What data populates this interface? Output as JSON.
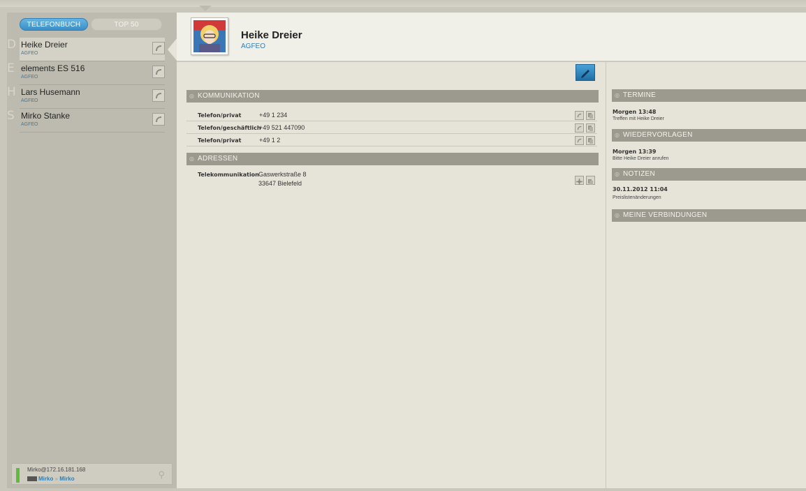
{
  "sidebar": {
    "tabs": [
      {
        "label": "TELEFONBUCH",
        "active": true
      },
      {
        "label": "TOP 50",
        "active": false
      }
    ],
    "contacts": [
      {
        "letter": "D",
        "name": "Heike Dreier",
        "org": "AGFEO",
        "selected": true
      },
      {
        "letter": "E",
        "name": "elements ES 516",
        "org": "AGFEO",
        "selected": false
      },
      {
        "letter": "H",
        "name": "Lars Husemann",
        "org": "AGFEO",
        "selected": false
      },
      {
        "letter": "S",
        "name": "Mirko Stanke",
        "org": "AGFEO",
        "selected": false
      }
    ],
    "status": {
      "user": "Mirko@172.16.181.168",
      "line_from": "Mirko",
      "line_sep": "»",
      "line_to": "Mirko",
      "status_color": "#5fbb3a"
    }
  },
  "header": {
    "name": "Heike Dreier",
    "org": "AGFEO"
  },
  "main": {
    "edit_icon": "pencil-icon",
    "kommunikation": {
      "title": "KOMMUNIKATION",
      "rows": [
        {
          "label": "Telefon/privat",
          "value": "+49 1 234"
        },
        {
          "label": "Telefon/geschäftlich",
          "value": "+49 521 447090"
        },
        {
          "label": "Telefon/privat",
          "value": "+49 1 2"
        }
      ]
    },
    "adressen": {
      "title": "ADRESSEN",
      "label": "Telekommunikation",
      "street": "Gaswerkstraße 8",
      "city": "33647 Bielefeld"
    }
  },
  "right": {
    "termine": {
      "title": "TERMINE",
      "time": "Morgen 13:48",
      "text": "Treffen mit Heike Dreier"
    },
    "wiedervorlagen": {
      "title": "WIEDERVORLAGEN",
      "time": "Morgen 13:39",
      "text": "Bitte Heike Dreier anrufen"
    },
    "notizen": {
      "title": "NOTIZEN",
      "time": "30.11.2012 11:04",
      "text": "Preislistenänderungen"
    },
    "verbindungen": {
      "title": "MEINE VERBINDUNGEN"
    }
  },
  "colors": {
    "accent": "#2f7eb5",
    "section": "#9c9a8f",
    "panel": "#e6e4d9",
    "sidebar": "#bdbbaf"
  }
}
